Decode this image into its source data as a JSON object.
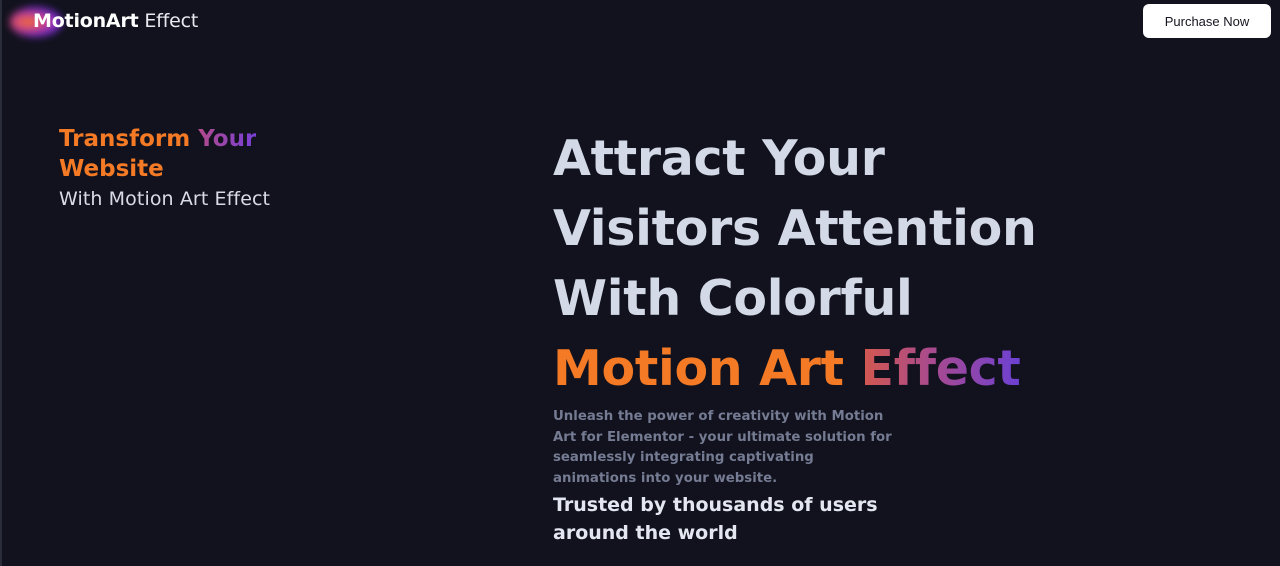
{
  "header": {
    "logo": {
      "bold": "MotionArt",
      "light": " Effect"
    },
    "purchase_label": "Purchase Now"
  },
  "intro": {
    "line1_orange": "Transform ",
    "line1_gradient": "Your",
    "line2_orange": "Website",
    "subline": "With Motion Art Effect"
  },
  "hero": {
    "line1": "Attract Your",
    "line2": "Visitors Attention",
    "line3": "With Colorful",
    "line4_orange": "Motion Art ",
    "line4_gradient": "Effect",
    "description": "Unleash the power of creativity with Motion Art for Elementor - your ultimate solution for seamlessly integrating captivating animations into your website.",
    "trusted": "Trusted by thousands of users around the world"
  },
  "colors": {
    "background": "#11121d",
    "accent_orange": "#f47a25",
    "accent_purple": "#7840d8",
    "heading": "#d3d9e6",
    "muted": "#747b92"
  }
}
